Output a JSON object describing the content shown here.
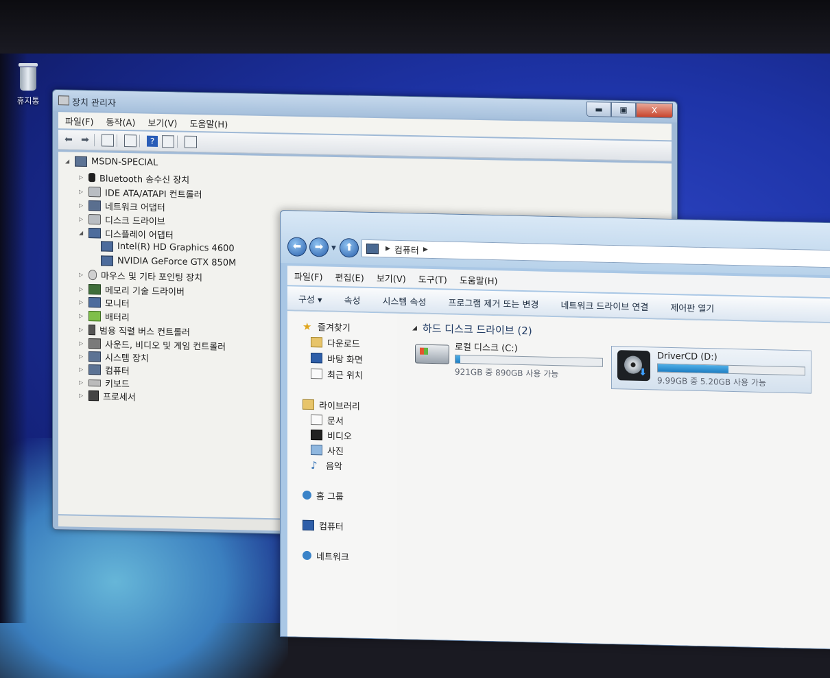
{
  "desktop": {
    "recycle_bin_label": "휴지통"
  },
  "device_manager": {
    "title": "장치 관리자",
    "caption_buttons": {
      "minimize": "▬",
      "maximize": "▣",
      "close": "X"
    },
    "menu": [
      "파일(F)",
      "동작(A)",
      "보기(V)",
      "도움말(H)"
    ],
    "tree": {
      "root": "MSDN-SPECIAL",
      "items": [
        {
          "label": "Bluetooth 송수신 장치",
          "icon": "bluetooth-icon",
          "expanded": false
        },
        {
          "label": "IDE ATA/ATAPI 컨트롤러",
          "icon": "ide-controller-icon",
          "expanded": false
        },
        {
          "label": "네트워크 어댑터",
          "icon": "network-adapter-icon",
          "expanded": false
        },
        {
          "label": "디스크 드라이브",
          "icon": "disk-drive-icon",
          "expanded": false
        },
        {
          "label": "디스플레이 어댑터",
          "icon": "display-adapter-icon",
          "expanded": true,
          "children": [
            "Intel(R) HD Graphics 4600",
            "NVIDIA GeForce GTX 850M"
          ]
        },
        {
          "label": "마우스 및 기타 포인팅 장치",
          "icon": "mouse-icon",
          "expanded": false
        },
        {
          "label": "메모리 기술 드라이버",
          "icon": "memory-icon",
          "expanded": false
        },
        {
          "label": "모니터",
          "icon": "monitor-icon",
          "expanded": false
        },
        {
          "label": "배터리",
          "icon": "battery-icon",
          "expanded": false
        },
        {
          "label": "범용 직렬 버스 컨트롤러",
          "icon": "usb-icon",
          "expanded": false
        },
        {
          "label": "사운드, 비디오 및 게임 컨트롤러",
          "icon": "sound-icon",
          "expanded": false
        },
        {
          "label": "시스템 장치",
          "icon": "system-device-icon",
          "expanded": false
        },
        {
          "label": "컴퓨터",
          "icon": "computer-icon",
          "expanded": false
        },
        {
          "label": "키보드",
          "icon": "keyboard-icon",
          "expanded": false
        },
        {
          "label": "프로세서",
          "icon": "processor-icon",
          "expanded": false
        }
      ]
    }
  },
  "explorer": {
    "address": {
      "location": "컴퓨터"
    },
    "menu": [
      "파일(F)",
      "편집(E)",
      "보기(V)",
      "도구(T)",
      "도움말(H)"
    ],
    "commands": [
      "구성 ▾",
      "속성",
      "시스템 속성",
      "프로그램 제거 또는 변경",
      "네트워크 드라이브 연결",
      "제어판 열기"
    ],
    "nav": {
      "favorites": {
        "label": "즐겨찾기",
        "items": [
          "다운로드",
          "바탕 화면",
          "최근 위치"
        ]
      },
      "libraries": {
        "label": "라이브러리",
        "items": [
          "문서",
          "비디오",
          "사진",
          "음악"
        ]
      },
      "homegroup": "홈 그룹",
      "computer": "컴퓨터",
      "network": "네트워크"
    },
    "section_header": "하드 디스크 드라이브 (2)",
    "drives": [
      {
        "name": "로컬 디스크 (C:)",
        "space": "921GB 중 890GB 사용 가능",
        "used_fraction": 0.034,
        "icon": "windows-drive-icon"
      },
      {
        "name": "DriverCD (D:)",
        "space": "9.99GB 중 5.20GB 사용 가능",
        "used_fraction": 0.48,
        "icon": "disc-drive-icon"
      }
    ]
  }
}
